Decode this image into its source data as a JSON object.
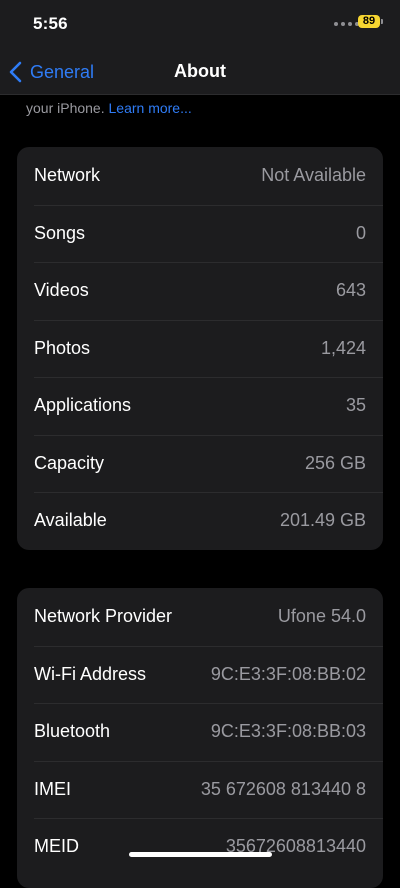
{
  "status_bar": {
    "time": "5:56",
    "battery_level": "89"
  },
  "nav": {
    "back_label": "General",
    "title": "About"
  },
  "intro": {
    "text": "your iPhone.",
    "link": "Learn more..."
  },
  "groups": [
    {
      "rows": [
        {
          "label": "Network",
          "value": "Not Available"
        },
        {
          "label": "Songs",
          "value": "0"
        },
        {
          "label": "Videos",
          "value": "643"
        },
        {
          "label": "Photos",
          "value": "1,424"
        },
        {
          "label": "Applications",
          "value": "35"
        },
        {
          "label": "Capacity",
          "value": "256 GB"
        },
        {
          "label": "Available",
          "value": "201.49 GB"
        }
      ]
    },
    {
      "rows": [
        {
          "label": "Network Provider",
          "value": "Ufone 54.0"
        },
        {
          "label": "Wi-Fi Address",
          "value": "9C:E3:3F:08:BB:02"
        },
        {
          "label": "Bluetooth",
          "value": "9C:E3:3F:08:BB:03"
        },
        {
          "label": "IMEI",
          "value": "35 672608 813440 8"
        },
        {
          "label": "MEID",
          "value": "35672608813440"
        }
      ]
    }
  ],
  "colors": {
    "accent": "#2f7cf6",
    "battery": "#f6d531",
    "background": "#000000",
    "cell": "#1c1c1e"
  }
}
